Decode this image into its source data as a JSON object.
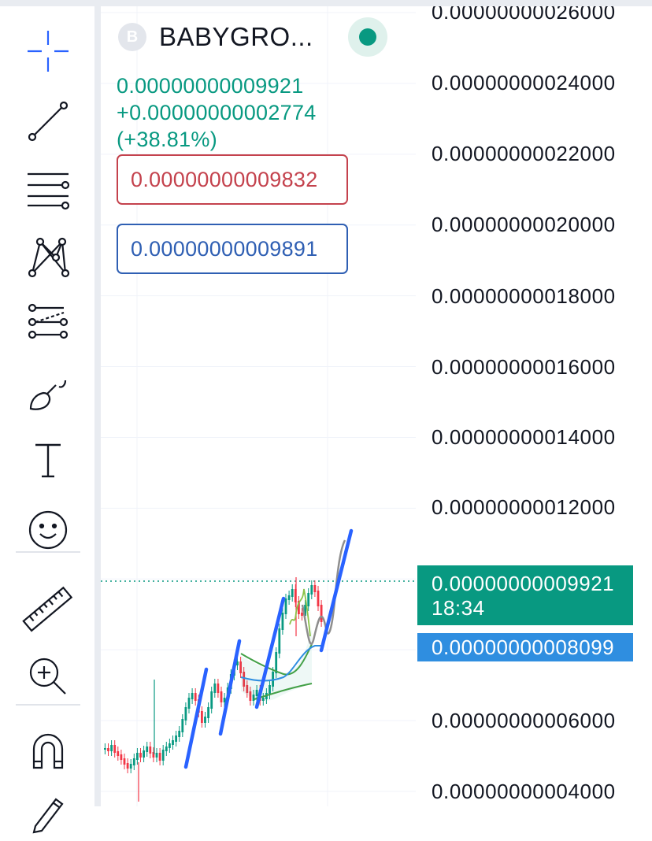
{
  "toolbar": {
    "tools": [
      {
        "name": "crosshair-icon"
      },
      {
        "name": "trend-line-icon"
      },
      {
        "name": "fib-levels-icon"
      },
      {
        "name": "pattern-icon"
      },
      {
        "name": "projection-icon"
      },
      {
        "name": "brush-icon"
      },
      {
        "name": "text-icon"
      },
      {
        "name": "emoji-icon"
      },
      {
        "name": "ruler-icon"
      },
      {
        "name": "zoom-in-icon"
      },
      {
        "name": "magnet-icon"
      },
      {
        "name": "pencil-icon"
      }
    ]
  },
  "legend": {
    "logo_letter": "B",
    "symbol": "BABYGRO...",
    "price": "0.00000000009921",
    "change": "+0.00000000002774",
    "change_pct": "(+38.81%)",
    "bid": "0.00000000009832",
    "ask": "0.00000000009891"
  },
  "price_axis": {
    "ticks": [
      "0.00000000026000",
      "0.00000000024000",
      "0.00000000022000",
      "0.00000000020000",
      "0.00000000018000",
      "0.00000000016000",
      "0.00000000014000",
      "0.00000000012000",
      "0.00000000006000",
      "0.00000000004000"
    ],
    "last_price": "0.00000000009921",
    "countdown": "18:34",
    "ma_price": "0.00000000008099"
  },
  "colors": {
    "up": "#089981",
    "down": "#f23645",
    "drawing": "#2962ff",
    "ma": "#2f8ee0"
  }
}
